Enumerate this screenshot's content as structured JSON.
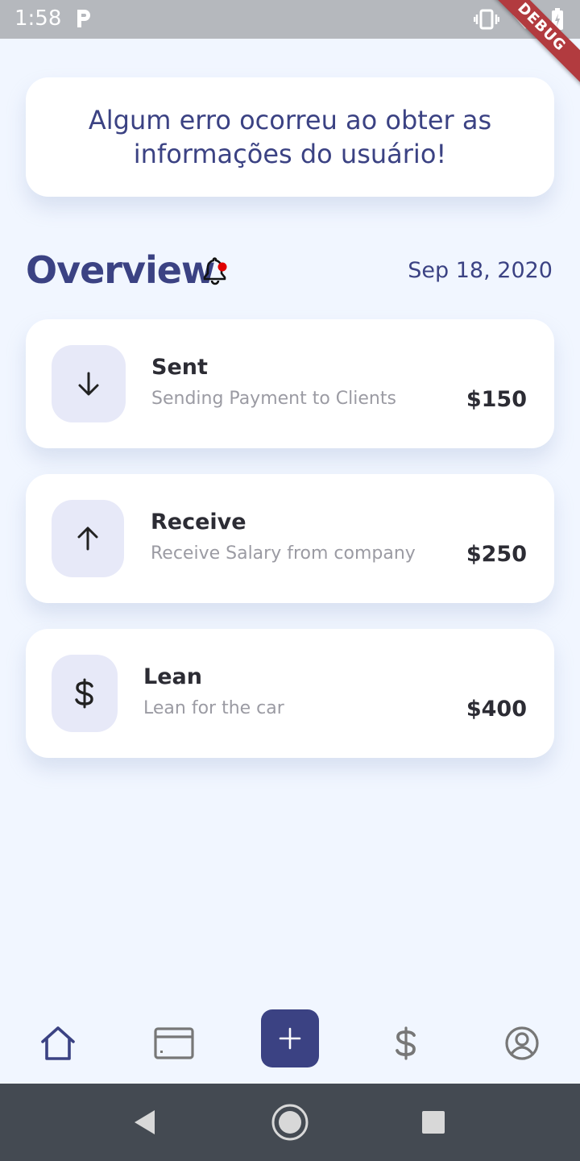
{
  "status_bar": {
    "time": "1:58",
    "debug_label": "DEBUG"
  },
  "error_message": "Algum erro ocorreu ao obter as informações do usuário!",
  "overview": {
    "title": "Overview",
    "date": "Sep 18, 2020"
  },
  "transactions": [
    {
      "title": "Sent",
      "subtitle": "Sending Payment to Clients",
      "amount": "$150",
      "icon": "arrow-down-icon"
    },
    {
      "title": "Receive",
      "subtitle": "Receive Salary from company",
      "amount": "$250",
      "icon": "arrow-up-icon"
    },
    {
      "title": "Lean",
      "subtitle": "Lean for the car",
      "amount": "$400",
      "icon": "dollar-icon"
    }
  ],
  "bottom_nav": {
    "items": [
      "home-icon",
      "card-icon",
      "add-icon",
      "dollar-icon",
      "profile-icon"
    ],
    "active": "home-icon"
  },
  "colors": {
    "primary": "#3b4283",
    "background": "#f1f6ff",
    "icon_box": "#e7e9f8",
    "notification_dot": "#e00000"
  }
}
